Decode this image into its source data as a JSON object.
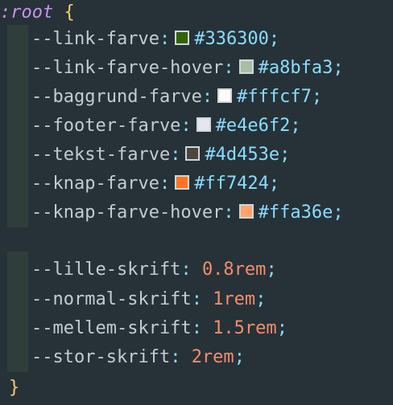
{
  "code": {
    "selector": ":root",
    "open_brace": "{",
    "close_brace": "}",
    "colors": [
      {
        "name": "--link-farve",
        "value": "#336300",
        "swatch": "#336300"
      },
      {
        "name": "--link-farve-hover",
        "value": "#a8bfa3",
        "swatch": "#a8bfa3"
      },
      {
        "name": "--baggrund-farve",
        "value": "#fffcf7",
        "swatch": "#fffcf7"
      },
      {
        "name": "--footer-farve",
        "value": "#e4e6f2",
        "swatch": "#e4e6f2"
      },
      {
        "name": "--tekst-farve",
        "value": "#4d453e",
        "swatch": "#4d453e"
      },
      {
        "name": "--knap-farve",
        "value": "#ff7424",
        "swatch": "#ff7424"
      },
      {
        "name": "--knap-farve-hover",
        "value": "#ffa36e",
        "swatch": "#ffa36e"
      }
    ],
    "sizes": [
      {
        "name": "--lille-skrift",
        "number": "0.8",
        "unit": "rem"
      },
      {
        "name": "--normal-skrift",
        "number": "1",
        "unit": "rem"
      },
      {
        "name": "--mellem-skrift",
        "number": "1.5",
        "unit": "rem"
      },
      {
        "name": "--stor-skrift",
        "number": "2",
        "unit": "rem"
      }
    ],
    "colon": ":",
    "semicolon": ";"
  },
  "theme": {
    "background": "#263238",
    "guide": "#2f3e3b",
    "selector": "#c792ea",
    "brace": "#ffcb6b",
    "property": "#c3ccd4",
    "punctuation": "#89ddff",
    "number": "#f78c6c"
  }
}
